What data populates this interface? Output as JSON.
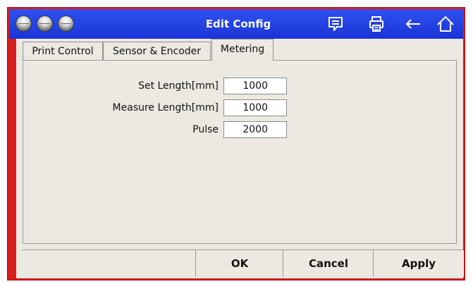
{
  "window": {
    "title": "Edit Config",
    "icons": [
      "traffic-light-dot",
      "traffic-light-dot",
      "traffic-light-dot",
      "chat-icon",
      "printer-icon",
      "back-arrow-icon",
      "home-icon"
    ]
  },
  "tabs": [
    {
      "label": "Print Control",
      "active": false
    },
    {
      "label": "Sensor & Encoder",
      "active": false
    },
    {
      "label": "Metering",
      "active": true
    }
  ],
  "metering": {
    "set_length_label": "Set Length[mm]",
    "set_length_value": "1000",
    "measure_length_label": "Measure Length[mm]",
    "measure_length_value": "1000",
    "pulse_label": "Pulse",
    "pulse_value": "2000"
  },
  "footer": {
    "ok_label": "OK",
    "cancel_label": "Cancel",
    "apply_label": "Apply"
  },
  "colors": {
    "frame": "#d81e1e",
    "titlebar": "#1f3fe6",
    "background": "#ece9e2"
  }
}
